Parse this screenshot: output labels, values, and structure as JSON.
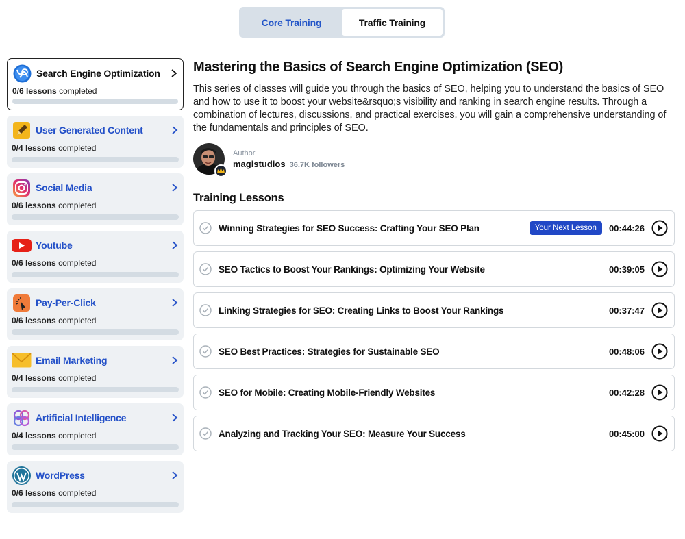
{
  "tabs": [
    {
      "label": "Core Training",
      "active": false
    },
    {
      "label": "Traffic Training",
      "active": true
    }
  ],
  "sidebar": {
    "lessons_suffix": "lessons completed",
    "categories": [
      {
        "title": "Search Engine Optimization",
        "progress": "0/6",
        "completed_fraction": 0,
        "icon": "seo-icon",
        "active": true
      },
      {
        "title": "User Generated Content",
        "progress": "0/4",
        "completed_fraction": 0,
        "icon": "pencil-icon",
        "active": false
      },
      {
        "title": "Social Media",
        "progress": "0/6",
        "completed_fraction": 0,
        "icon": "instagram-icon",
        "active": false
      },
      {
        "title": "Youtube",
        "progress": "0/6",
        "completed_fraction": 0,
        "icon": "youtube-icon",
        "active": false
      },
      {
        "title": "Pay-Per-Click",
        "progress": "0/6",
        "completed_fraction": 0,
        "icon": "cursor-click-icon",
        "active": false
      },
      {
        "title": "Email Marketing",
        "progress": "0/4",
        "completed_fraction": 0,
        "icon": "envelope-icon",
        "active": false
      },
      {
        "title": "Artificial Intelligence",
        "progress": "0/4",
        "completed_fraction": 0,
        "icon": "ai-brain-icon",
        "active": false
      },
      {
        "title": "WordPress",
        "progress": "0/6",
        "completed_fraction": 0,
        "icon": "wordpress-icon",
        "active": false
      }
    ]
  },
  "course": {
    "title": "Mastering the Basics of Search Engine Optimization (SEO)",
    "description": "This series of classes will guide you through the basics of SEO, helping you to understand the basics of SEO and how to use it to boost your website&rsquo;s visibility and ranking in search engine results. Through a combination of lectures, discussions, and practical exercises, you will gain a comprehensive understanding of the fundamentals and principles of SEO.",
    "author_label": "Author",
    "author_name": "magistudios",
    "followers": "36.7K followers"
  },
  "lessons_section": {
    "title": "Training Lessons",
    "next_badge": "Your Next Lesson",
    "lessons": [
      {
        "title": "Winning Strategies for SEO Success: Crafting Your SEO Plan",
        "duration": "00:44:26",
        "is_next": true
      },
      {
        "title": "SEO Tactics to Boost Your Rankings: Optimizing Your Website",
        "duration": "00:39:05",
        "is_next": false
      },
      {
        "title": "Linking Strategies for SEO: Creating Links to Boost Your Rankings",
        "duration": "00:37:47",
        "is_next": false
      },
      {
        "title": "SEO Best Practices: Strategies for Sustainable SEO",
        "duration": "00:48:06",
        "is_next": false
      },
      {
        "title": "SEO for Mobile: Creating Mobile-Friendly Websites",
        "duration": "00:42:28",
        "is_next": false
      },
      {
        "title": "Analyzing and Tracking Your SEO: Measure Your Success",
        "duration": "00:45:00",
        "is_next": false
      }
    ]
  },
  "colors": {
    "accent": "#2350c8",
    "badge": "#2148c6",
    "card_bg": "#eef1f4"
  }
}
